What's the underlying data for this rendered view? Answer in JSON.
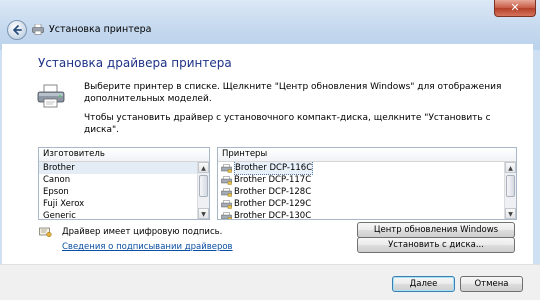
{
  "window": {
    "title": "Установка принтера",
    "close_symbol": "✕",
    "back_icon": "back-arrow-icon"
  },
  "content": {
    "heading": "Установка драйвера принтера",
    "instruction1": "Выберите принтер в списке. Щелкните \"Центр обновления Windows\" для отображения дополнительных моделей.",
    "instruction2": "Чтобы установить драйвер с установочного компакт-диска, щелкните \"Установить с диска\"."
  },
  "manufacturers": {
    "header": "Изготовитель",
    "items": [
      "Brother",
      "Canon",
      "Epson",
      "Fuji Xerox",
      "Generic"
    ],
    "selected": "Brother"
  },
  "printers": {
    "header": "Принтеры",
    "items": [
      "Brother DCP-116C",
      "Brother DCP-117C",
      "Brother DCP-128C",
      "Brother DCP-129C",
      "Brother DCP-130C"
    ],
    "selected": "Brother DCP-116C"
  },
  "signature": {
    "text": "Драйвер имеет цифровую подпись.",
    "link": "Сведения о подписывании драйверов"
  },
  "buttons": {
    "windows_update": "Центр обновления Windows",
    "have_disk": "Установить с диска...",
    "next": "Далее",
    "cancel": "Отмена"
  },
  "colors": {
    "heading": "#1e3287",
    "link": "#0a4fa3",
    "titlebar": "#c4d8ee"
  }
}
